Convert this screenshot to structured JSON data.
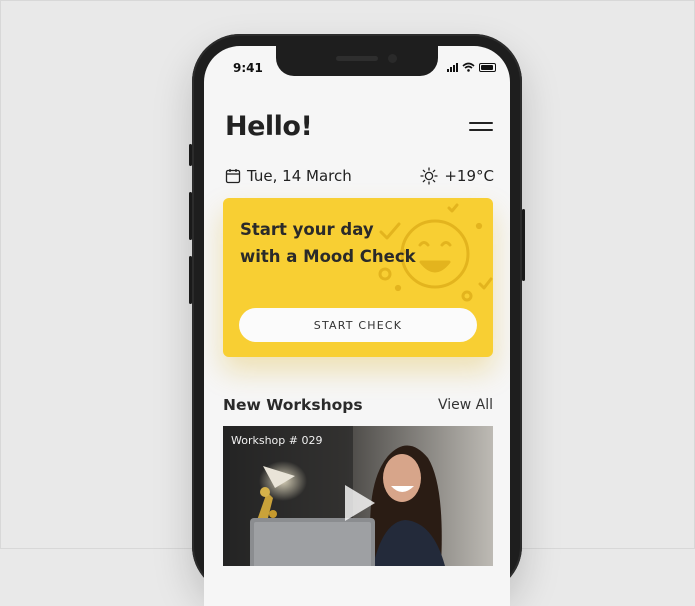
{
  "status_bar": {
    "time": "9:41"
  },
  "header": {
    "greeting": "Hello!"
  },
  "date_row": {
    "date": "Tue, 14 March",
    "temperature": "+19°C"
  },
  "mood_card": {
    "title_line1": "Start your day",
    "title_line2": "with a Mood Check",
    "button_label": "START CHECK",
    "accent_color": "#f8cf33"
  },
  "workshops": {
    "section_title": "New Workshops",
    "view_all_label": "View All",
    "items": [
      {
        "label": "Workshop # 029"
      }
    ]
  },
  "icons": [
    "menu-icon",
    "calendar-icon",
    "sun-icon",
    "play-icon",
    "signal-icon",
    "wifi-icon",
    "battery-icon"
  ]
}
